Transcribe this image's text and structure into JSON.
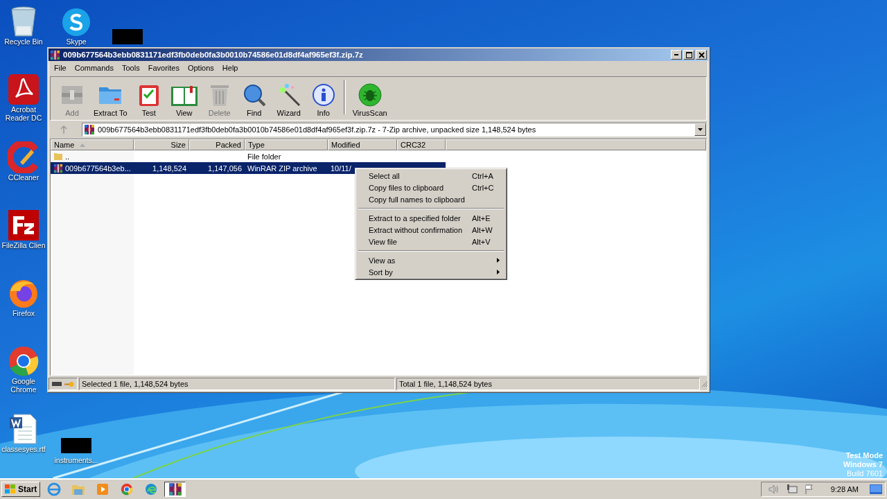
{
  "desktop_icons": [
    {
      "kind": "recycle",
      "label": "Recycle Bin"
    },
    {
      "kind": "skype",
      "label": "Skype"
    },
    {
      "kind": "redacted"
    },
    {
      "kind": "acrobat",
      "label": "Acrobat Reader DC"
    },
    {
      "kind": "ccleaner",
      "label": "CCleaner"
    },
    {
      "kind": "filezilla",
      "label": "FileZilla Clien"
    },
    {
      "kind": "firefox",
      "label": "Firefox"
    },
    {
      "kind": "chrome",
      "label": "Google Chrome"
    },
    {
      "kind": "word",
      "label": "classesyes.rtf"
    },
    {
      "kind": "redacted",
      "label": "instruments..."
    }
  ],
  "window": {
    "title": "009b677564b3ebb0831171edf3fb0deb0fa3b0010b74586e01d8df4af965ef3f.zip.7z",
    "menu": [
      "File",
      "Commands",
      "Tools",
      "Favorites",
      "Options",
      "Help"
    ],
    "toolbar": [
      {
        "kind": "add",
        "label": "Add",
        "disabled": true
      },
      {
        "kind": "extract",
        "label": "Extract To",
        "disabled": false
      },
      {
        "kind": "test",
        "label": "Test",
        "disabled": false
      },
      {
        "kind": "view",
        "label": "View",
        "disabled": false
      },
      {
        "kind": "delete",
        "label": "Delete",
        "disabled": true
      },
      {
        "kind": "find",
        "label": "Find",
        "disabled": false
      },
      {
        "kind": "wizard",
        "label": "Wizard",
        "disabled": false
      },
      {
        "kind": "info",
        "label": "Info",
        "disabled": false
      },
      {
        "kind": "virus",
        "label": "VirusScan",
        "disabled": false
      }
    ],
    "address": "009b677564b3ebb0831171edf3fb0deb0fa3b0010b74586e01d8df4af965ef3f.zip.7z - 7-Zip archive, unpacked size 1,148,524 bytes",
    "columns": [
      {
        "label": "Name",
        "sorted": true
      },
      {
        "label": "Size",
        "sorted": false
      },
      {
        "label": "Packed",
        "sorted": false
      },
      {
        "label": "Type",
        "sorted": false
      },
      {
        "label": "Modified",
        "sorted": false
      },
      {
        "label": "CRC32",
        "sorted": false
      }
    ],
    "rows": [
      {
        "kind": "folder",
        "name": "..",
        "type": "File folder",
        "selected": false
      },
      {
        "kind": "archive",
        "name": "009b677564b3eb...",
        "size": "1,148,524",
        "packed": "1,147,056",
        "type": "WinRAR ZIP archive",
        "modified": "10/11/",
        "selected": true
      }
    ],
    "status": {
      "left": "Selected 1 file, 1,148,524 bytes",
      "right": "Total 1 file, 1,148,524 bytes"
    }
  },
  "context_menu": [
    [
      {
        "label": "Select all",
        "shortcut": "Ctrl+A",
        "submenu": false
      },
      {
        "label": "Copy files to clipboard",
        "shortcut": "Ctrl+C",
        "submenu": false
      },
      {
        "label": "Copy full names to clipboard",
        "submenu": false
      }
    ],
    [
      {
        "label": "Extract to a specified folder",
        "shortcut": "Alt+E",
        "submenu": false
      },
      {
        "label": "Extract without confirmation",
        "shortcut": "Alt+W",
        "submenu": false
      },
      {
        "label": "View file",
        "shortcut": "Alt+V",
        "submenu": false
      }
    ],
    [
      {
        "label": "View as",
        "submenu": true
      },
      {
        "label": "Sort by",
        "submenu": true
      }
    ]
  ],
  "watermark_text": [
    "Test Mode",
    "Windows 7",
    "Build 7601"
  ],
  "taskbar": {
    "start": "Start",
    "apps": [
      {
        "kind": "ie",
        "active": false
      },
      {
        "kind": "explorer",
        "active": false
      },
      {
        "kind": "media",
        "active": false
      },
      {
        "kind": "chrome",
        "active": false
      },
      {
        "kind": "edge",
        "active": false
      },
      {
        "kind": "winrar",
        "active": true
      }
    ],
    "clock": "9:28 AM"
  }
}
